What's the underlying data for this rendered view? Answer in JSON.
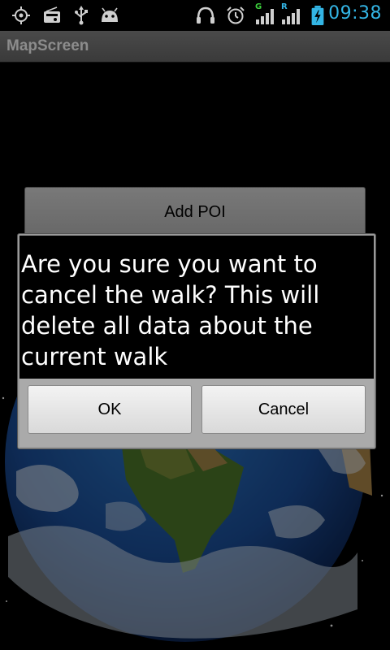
{
  "status_bar": {
    "time": "09:38",
    "icons": [
      "gps-icon",
      "radio-icon",
      "usb-icon",
      "android-debug-icon",
      "headset-icon",
      "alarm-icon",
      "signal-g-icon",
      "signal-r-icon",
      "battery-charging-icon"
    ],
    "signal_labels": {
      "g": "G",
      "r": "R"
    },
    "accent_color": "#33b5e5"
  },
  "app": {
    "title": "MapScreen"
  },
  "background_buttons": {
    "add_poi": "Add POI",
    "second": "",
    "third": ""
  },
  "dialog": {
    "message": "Are you sure you want to cancel the walk? This will delete all data about the current walk",
    "ok_label": "OK",
    "cancel_label": "Cancel"
  }
}
